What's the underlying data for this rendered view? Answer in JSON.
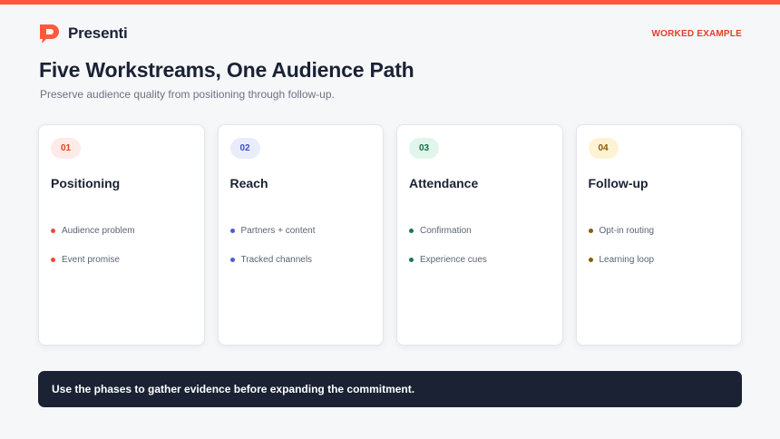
{
  "brand": {
    "name": "Presenti",
    "accent": "#ff5a3c",
    "logo_icon": "presenti-p-logo-icon"
  },
  "tag": {
    "label": "WORKED EXAMPLE",
    "color": "#e0412a"
  },
  "header": {
    "title": "Five Workstreams, One Audience Path",
    "subtitle": "Preserve audience quality from positioning through follow-up."
  },
  "cards": [
    {
      "number": "01",
      "title": "Positioning",
      "badge_bg": "#fdebe7",
      "badge_fg": "#e0412a",
      "dot_color": "#ef4a33",
      "bullets": [
        "Audience problem",
        "Event promise"
      ]
    },
    {
      "number": "02",
      "title": "Reach",
      "badge_bg": "#e9ecfb",
      "badge_fg": "#3b4fc4",
      "dot_color": "#4a5fd0",
      "bullets": [
        "Partners + content",
        "Tracked channels"
      ]
    },
    {
      "number": "03",
      "title": "Attendance",
      "badge_bg": "#e2f5ec",
      "badge_fg": "#136b43",
      "dot_color": "#1a7a4c",
      "bullets": [
        "Confirmation",
        "Experience cues"
      ]
    },
    {
      "number": "04",
      "title": "Follow-up",
      "badge_bg": "#fdf2d3",
      "badge_fg": "#8a5a00",
      "dot_color": "#8a5a00",
      "bullets": [
        "Opt-in routing",
        "Learning loop"
      ]
    }
  ],
  "footer": {
    "text": "Use the phases to gather evidence before expanding the commitment.",
    "bg": "#1a2234"
  }
}
